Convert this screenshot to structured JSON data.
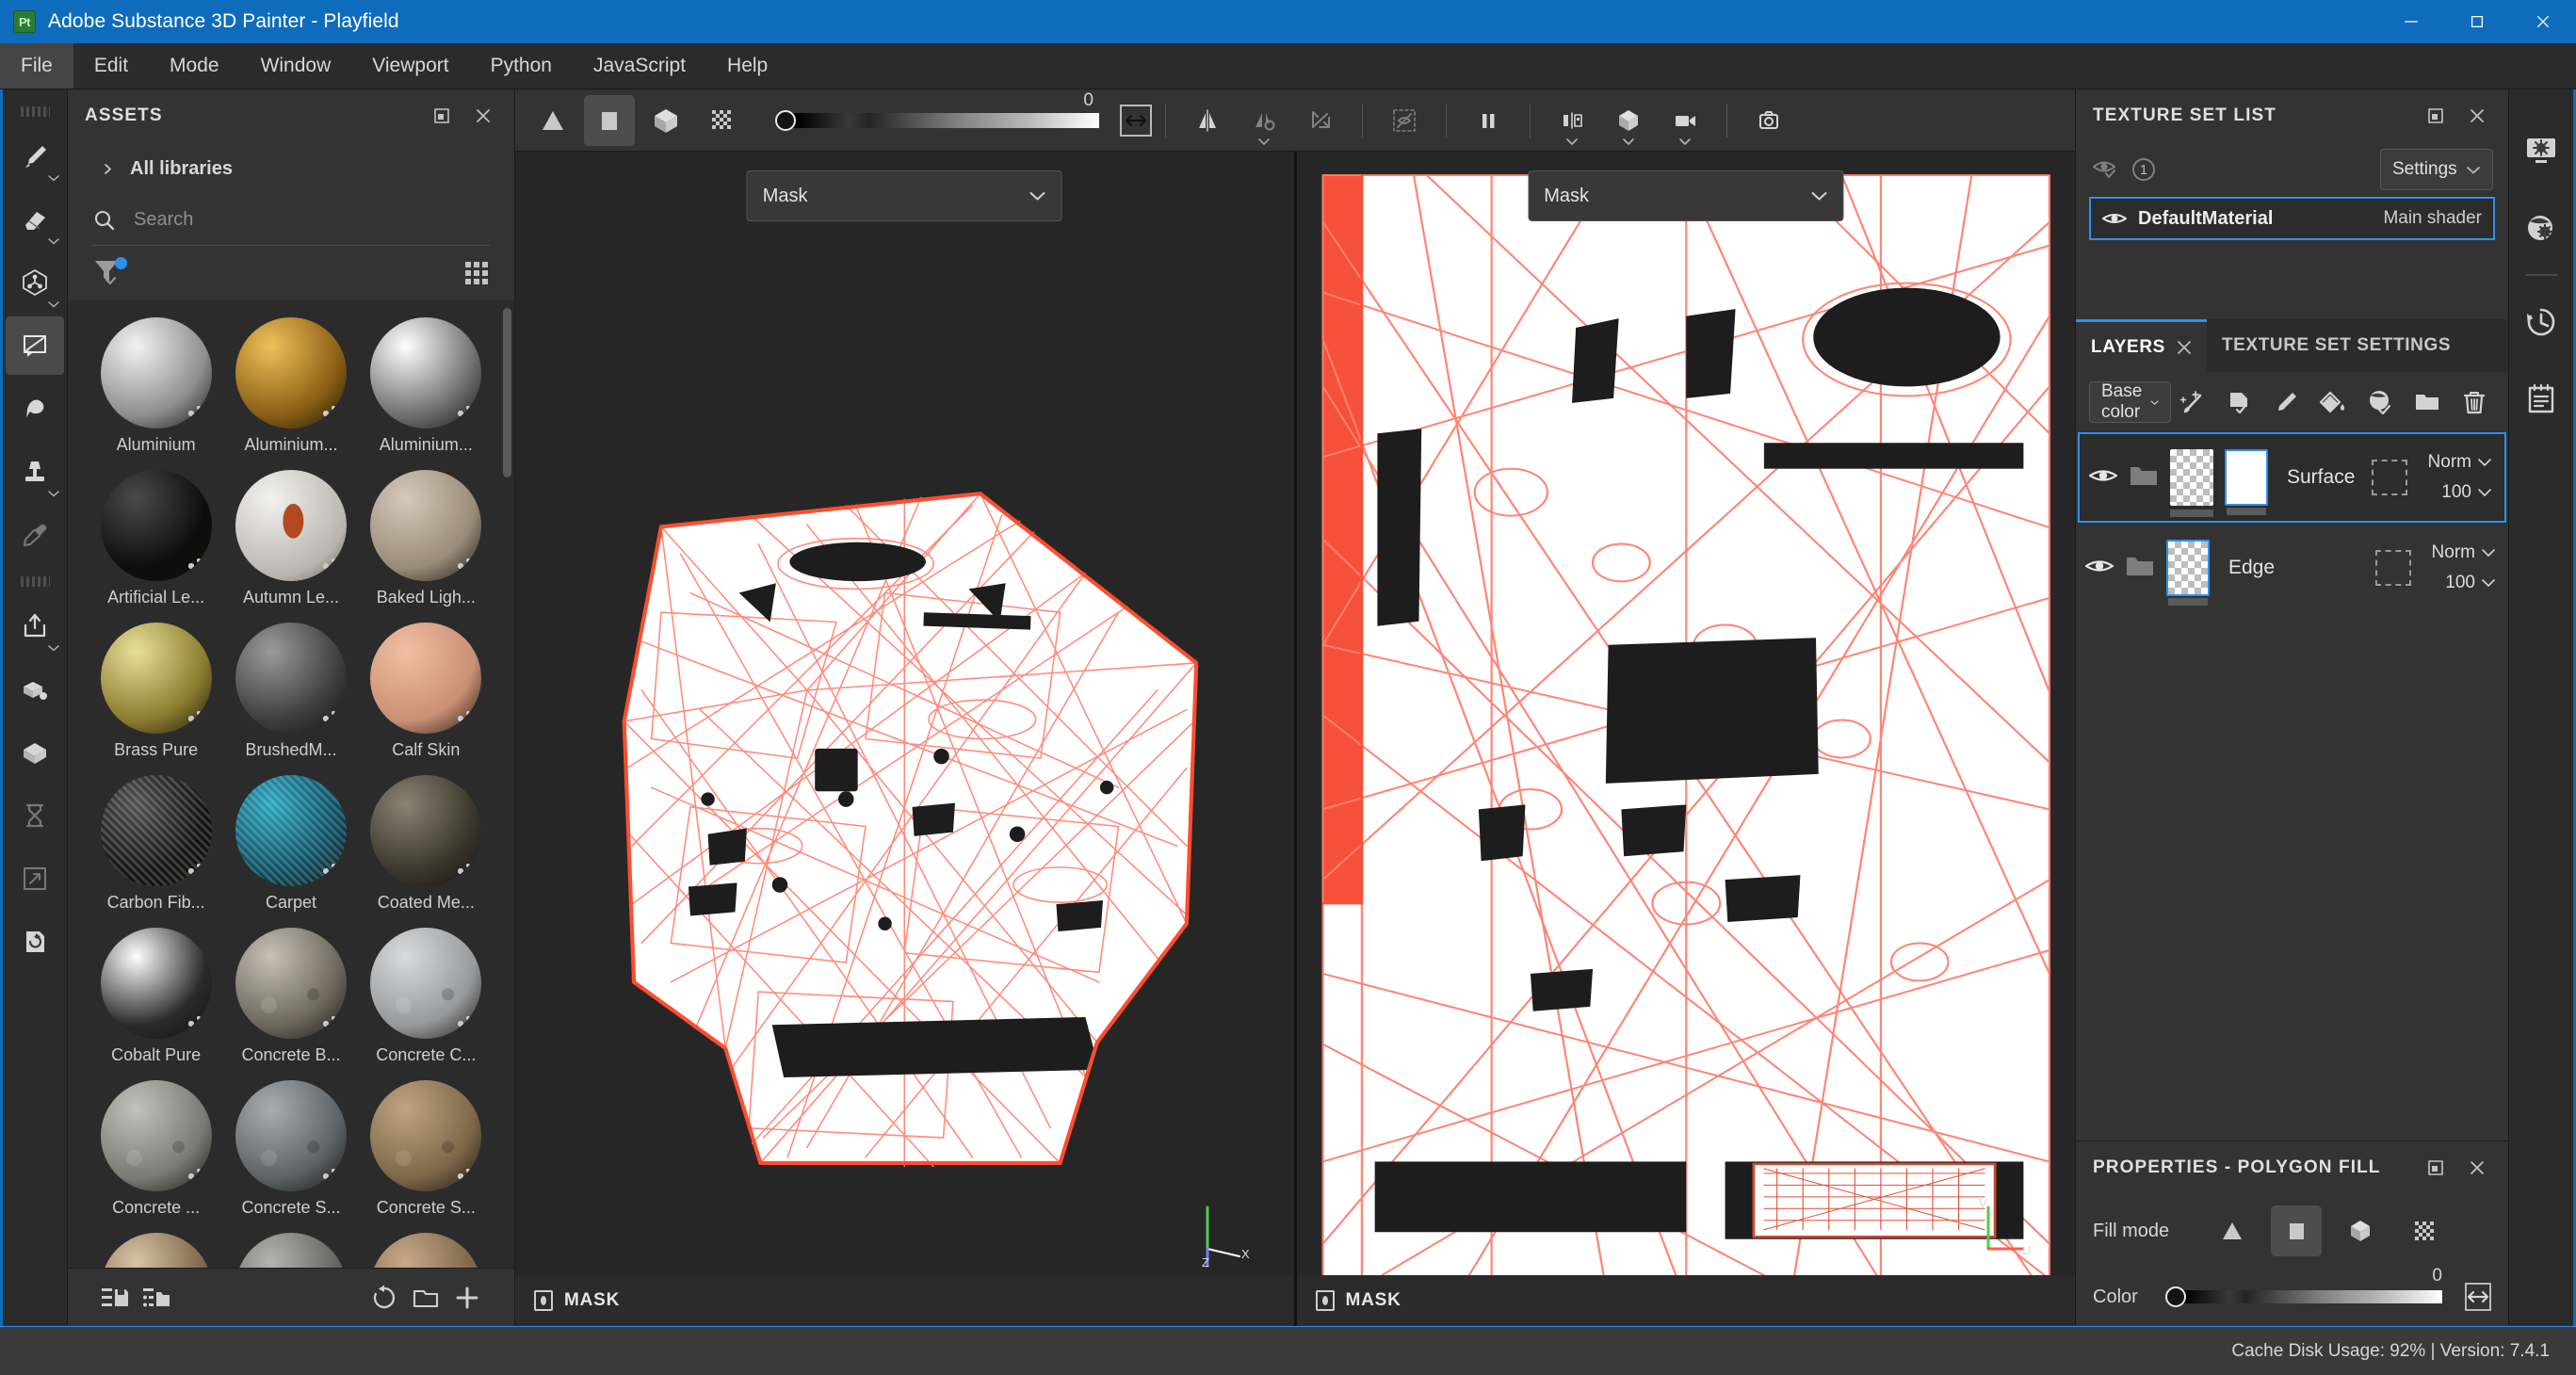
{
  "window": {
    "app_icon": "Pt",
    "title": "Adobe Substance 3D Painter - Playfield",
    "minimize": "─",
    "maximize": "□",
    "close": "✕"
  },
  "menubar": {
    "items": [
      "File",
      "Edit",
      "Mode",
      "Window",
      "Viewport",
      "Python",
      "JavaScript",
      "Help"
    ]
  },
  "left_toolbar": {
    "tools": [
      {
        "name": "paint-brush-tool",
        "icon": "brush-icon",
        "active": false,
        "caret": true,
        "dim": false
      },
      {
        "name": "eraser-tool",
        "icon": "eraser-icon",
        "active": false,
        "caret": true,
        "dim": false
      },
      {
        "name": "projection-tool",
        "icon": "projection-cube-icon",
        "active": false,
        "caret": true,
        "dim": false
      },
      {
        "name": "polygon-fill-tool",
        "icon": "polygon-fill-icon",
        "active": true,
        "caret": false,
        "dim": false
      },
      {
        "name": "smudge-tool",
        "icon": "smudge-icon",
        "active": false,
        "caret": false,
        "dim": false
      },
      {
        "name": "clone-tool",
        "icon": "clone-stamp-icon",
        "active": false,
        "caret": true,
        "dim": false
      },
      {
        "name": "material-picker-tool",
        "icon": "eyedropper-icon",
        "active": false,
        "caret": false,
        "dim": true
      },
      {
        "name": "export-textures-tool",
        "icon": "export-icon",
        "active": false,
        "caret": true,
        "dim": false
      },
      {
        "name": "bake-mesh-maps-tool",
        "icon": "bake-icon",
        "active": false,
        "caret": false,
        "dim": false
      },
      {
        "name": "geometry-mask-tool",
        "icon": "geometry-icon",
        "active": false,
        "caret": false,
        "dim": false
      },
      {
        "name": "baking-progress-tool",
        "icon": "hourglass-icon",
        "active": false,
        "caret": false,
        "dim": true
      },
      {
        "name": "resize-tool",
        "icon": "expand-arrows-icon",
        "active": false,
        "caret": false,
        "dim": true
      },
      {
        "name": "reload-tool",
        "icon": "reload-file-icon",
        "active": false,
        "caret": false,
        "dim": false
      }
    ]
  },
  "assets": {
    "panel_title": "ASSETS",
    "maximize_icon": "maximize-panel-icon",
    "close_icon": "close-panel-icon",
    "library_label": "All libraries",
    "search": {
      "placeholder": "Search",
      "value": "",
      "icon": "search-icon"
    },
    "filter_icon": "filter-icon",
    "grid_view_icon": "grid-view-icon",
    "items": [
      {
        "label": "Aluminium",
        "color1": "#f3f3f3",
        "color2": "#8e8e8e",
        "type": "metal"
      },
      {
        "label": "Aluminium...",
        "color1": "#f0c05a",
        "color2": "#8a5f14",
        "type": "metal"
      },
      {
        "label": "Aluminium...",
        "color1": "#ffffff",
        "color2": "#6f6f6f",
        "type": "metal"
      },
      {
        "label": "Artificial Le...",
        "color1": "#4a4a4a",
        "color2": "#0d0d0d",
        "type": "leather"
      },
      {
        "label": "Autumn Le...",
        "color1": "#f2f2f0",
        "color2": "#b9b5ae",
        "type": "leaf"
      },
      {
        "label": "Baked Ligh...",
        "color1": "#d6c9b9",
        "color2": "#9b8b7a",
        "type": "plain"
      },
      {
        "label": "Brass Pure",
        "color1": "#e8df9a",
        "color2": "#8a7c2e",
        "type": "metal"
      },
      {
        "label": "BrushedM...",
        "color1": "#9b9b9b",
        "color2": "#3d3d3d",
        "type": "metal"
      },
      {
        "label": "Calf Skin",
        "color1": "#f0bfa4",
        "color2": "#cb8f74",
        "type": "plain"
      },
      {
        "label": "Carbon Fib...",
        "color1": "#4f4f4f",
        "color2": "#111111",
        "type": "carbon"
      },
      {
        "label": "Carpet",
        "color1": "#2aa3bd",
        "color2": "#0a4b5e",
        "type": "carpet"
      },
      {
        "label": "Coated Me...",
        "color1": "#8b8372",
        "color2": "#3a352c",
        "type": "plain"
      },
      {
        "label": "Cobalt Pure",
        "color1": "#ffffff",
        "color2": "#2a2a2a",
        "type": "metal"
      },
      {
        "label": "Concrete B...",
        "color1": "#c8c1b6",
        "color2": "#6d665c",
        "type": "concrete"
      },
      {
        "label": "Concrete C...",
        "color1": "#d9dadb",
        "color2": "#97999b",
        "type": "concrete"
      },
      {
        "label": "Concrete ...",
        "color1": "#c2c2bd",
        "color2": "#7a7a74",
        "type": "concrete"
      },
      {
        "label": "Concrete S...",
        "color1": "#a8adb0",
        "color2": "#5c6265",
        "type": "concrete"
      },
      {
        "label": "Concrete S...",
        "color1": "#c0a482",
        "color2": "#7d6747",
        "type": "concrete"
      },
      {
        "label": "",
        "color1": "#d9c4a8",
        "color2": "#7a6448",
        "type": "concrete"
      },
      {
        "label": "",
        "color1": "#b5b5b0",
        "color2": "#616160",
        "type": "concrete"
      },
      {
        "label": "",
        "color1": "#c8a98a",
        "color2": "#7b6348",
        "type": "concrete"
      }
    ],
    "footer_buttons": [
      {
        "name": "save-to-shelf-button",
        "icon": "list-save-icon"
      },
      {
        "name": "shelf-folder-button",
        "icon": "list-folder-icon"
      },
      {
        "name": "refresh-assets-button",
        "icon": "refresh-icon"
      },
      {
        "name": "open-folder-button",
        "icon": "folder-icon"
      },
      {
        "name": "add-asset-button",
        "icon": "plus-icon"
      }
    ]
  },
  "toolbar": {
    "fill_modes": [
      {
        "name": "fill-mode-triangle",
        "icon": "triangle-icon",
        "active": false
      },
      {
        "name": "fill-mode-quad",
        "icon": "square-icon",
        "active": true
      },
      {
        "name": "fill-mode-mesh",
        "icon": "cube-icon",
        "active": false
      },
      {
        "name": "fill-mode-uv-chunk",
        "icon": "checker-icon",
        "active": false
      }
    ],
    "color_value": "0",
    "swap_icon": "swap-color-icon",
    "right_buttons": [
      {
        "name": "symmetry-button",
        "icon": "symmetry-icon",
        "caret": false,
        "dim": false
      },
      {
        "name": "symmetry-settings-button",
        "icon": "symmetry-settings-icon",
        "caret": true,
        "dim": true
      },
      {
        "name": "projection-settings-button",
        "icon": "uv-projection-icon",
        "caret": false,
        "dim": true
      },
      {
        "name": "hide-selection-button",
        "icon": "hide-selection-icon",
        "caret": false,
        "dim": true
      },
      {
        "name": "pause-engine-button",
        "icon": "pause-icon",
        "caret": false,
        "dim": false
      },
      {
        "name": "split-view-button",
        "icon": "split-view-icon",
        "caret": true,
        "dim": false
      },
      {
        "name": "three-d-view-button",
        "icon": "cube-view-icon",
        "caret": true,
        "dim": false
      },
      {
        "name": "camera-button",
        "icon": "camera-video-icon",
        "caret": true,
        "dim": false
      },
      {
        "name": "screenshot-button",
        "icon": "screenshot-camera-icon",
        "caret": false,
        "dim": false
      }
    ]
  },
  "viewports": [
    {
      "name": "viewport-3d",
      "channel": "Mask",
      "footer_label": "MASK",
      "footer_icon": "mask-icon",
      "axis_labels": [
        "X",
        "Z"
      ]
    },
    {
      "name": "viewport-2d",
      "channel": "Mask",
      "footer_label": "MASK",
      "footer_icon": "mask-icon",
      "axis_labels": [
        "V",
        "U"
      ]
    }
  ],
  "texture_set_list": {
    "panel_title": "TEXTURE SET LIST",
    "maximize_icon": "maximize-panel-icon",
    "close_icon": "close-panel-icon",
    "visibility_icon": "eye-toggle-icon",
    "count_badge": "1",
    "settings_label": "Settings",
    "sets": [
      {
        "name": "DefaultMaterial",
        "shader": "Main shader",
        "selected": true,
        "visible": true
      }
    ]
  },
  "layers_panel": {
    "tabs": [
      {
        "label": "LAYERS",
        "active": true,
        "closable": true
      },
      {
        "label": "TEXTURE SET SETTINGS",
        "active": false,
        "closable": false
      }
    ],
    "channel": "Base color",
    "toolbar_buttons": [
      {
        "name": "add-effect-button",
        "icon": "magic-wand-icon"
      },
      {
        "name": "add-mask-button",
        "icon": "add-mask-icon"
      },
      {
        "name": "add-paint-layer-button",
        "icon": "paint-brush-icon"
      },
      {
        "name": "add-fill-layer-button",
        "icon": "paint-bucket-icon"
      },
      {
        "name": "add-smart-material-button",
        "icon": "smart-material-icon"
      },
      {
        "name": "add-folder-button",
        "icon": "folder-icon"
      },
      {
        "name": "delete-layer-button",
        "icon": "trash-icon"
      }
    ],
    "layers": [
      {
        "name": "Surface",
        "selected": true,
        "visible": true,
        "blend": "Norm",
        "opacity": "100",
        "has_mask": true,
        "mask_white": true
      },
      {
        "name": "Edge",
        "selected": false,
        "visible": true,
        "blend": "Norm",
        "opacity": "100",
        "has_mask": false,
        "mask_white": false
      }
    ]
  },
  "properties_panel": {
    "panel_title": "PROPERTIES - POLYGON FILL",
    "maximize_icon": "maximize-panel-icon",
    "close_icon": "close-panel-icon",
    "fill_mode_label": "Fill mode",
    "fill_modes": [
      {
        "name": "prop-fill-mode-triangle",
        "icon": "triangle-icon",
        "active": false
      },
      {
        "name": "prop-fill-mode-quad",
        "icon": "square-icon",
        "active": true
      },
      {
        "name": "prop-fill-mode-mesh",
        "icon": "cube-icon",
        "active": false
      },
      {
        "name": "prop-fill-mode-uv-chunk",
        "icon": "checker-icon",
        "active": false
      }
    ],
    "color_label": "Color",
    "color_value": "0",
    "swap_icon": "swap-color-icon"
  },
  "right_rail": {
    "buttons": [
      {
        "name": "display-settings-button",
        "icon": "monitor-gear-icon"
      },
      {
        "name": "shader-settings-button",
        "icon": "sphere-gear-icon"
      },
      {
        "name": "history-button",
        "icon": "history-clock-icon"
      },
      {
        "name": "log-button",
        "icon": "notepad-icon"
      }
    ]
  },
  "statusbar": {
    "text": "Cache Disk Usage: 92% | Version: 7.4.1"
  }
}
